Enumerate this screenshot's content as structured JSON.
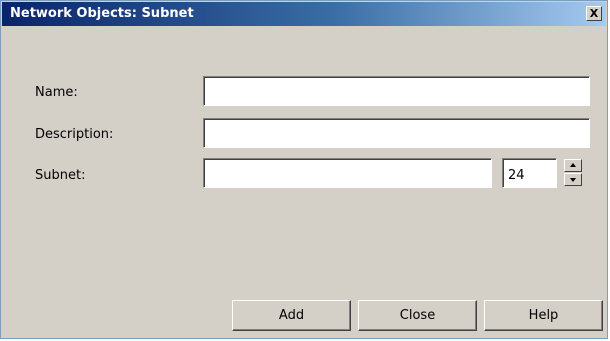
{
  "window": {
    "title": "Network Objects: Subnet",
    "close_glyph": "X"
  },
  "form": {
    "name_label": "Name:",
    "name_value": "",
    "description_label": "Description:",
    "description_value": "",
    "subnet_label": "Subnet:",
    "subnet_value": "",
    "prefix_value": "24"
  },
  "buttons": {
    "add": "Add",
    "close": "Close",
    "help": "Help"
  },
  "icons": {
    "spin_up": "spin-up-icon",
    "spin_down": "spin-down-icon"
  }
}
